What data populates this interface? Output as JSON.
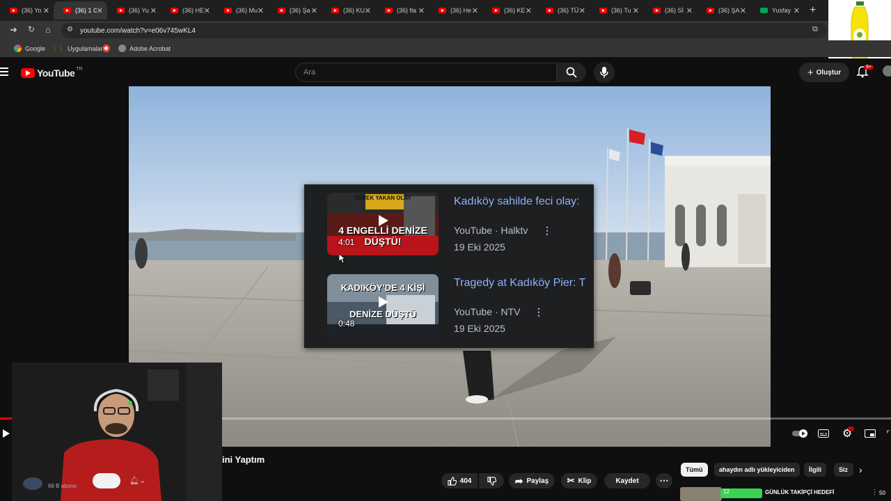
{
  "browser": {
    "tabs": [
      {
        "label": "(36) Yo",
        "active": false
      },
      {
        "label": "(36) 1 G",
        "active": true
      },
      {
        "label": "(36) Yu",
        "active": false
      },
      {
        "label": "(36) HE",
        "active": false
      },
      {
        "label": "(36) Mu",
        "active": false
      },
      {
        "label": "(36) Şa",
        "active": false
      },
      {
        "label": "(36) KU",
        "active": false
      },
      {
        "label": "(36) fla",
        "active": false
      },
      {
        "label": "(36) He",
        "active": false
      },
      {
        "label": "(36) KE",
        "active": false
      },
      {
        "label": "(36) TÜ",
        "active": false
      },
      {
        "label": "(36) Tu",
        "active": false
      },
      {
        "label": "(36) Sİ",
        "active": false
      },
      {
        "label": "(36) ŞA",
        "active": false
      },
      {
        "label": "Yusfay",
        "active": false
      }
    ],
    "url": "youtube.com/watch?v=e06v745wKL4",
    "bookmarks": [
      "Google",
      "Uygulamalar",
      "Adobe Acrobat"
    ]
  },
  "youtube": {
    "logo_text": "YouTube",
    "region": "TR",
    "search_placeholder": "Ara",
    "create_label": "Oluştur",
    "notification_count": "9+"
  },
  "popup": {
    "cards": [
      {
        "title": "Kadıköy sahilde feci olay: ",
        "source": "YouTube · Halktv",
        "date": "19 Eki 2025",
        "duration": "4:01",
        "thumb_text_top": "YÜREK YAKAN OLAY",
        "thumb_text_bottom": "4 ENGELLİ DENİZE DÜŞTÜ!"
      },
      {
        "title": "Tragedy at Kadıköy Pier: T",
        "source": "YouTube · NTV",
        "date": "19 Eki 2025",
        "duration": "0:48",
        "thumb_text_top": "KADIKÖY'DE 4 KİŞİ",
        "thumb_text_bottom": "DENİZE DÜŞTÜ"
      }
    ]
  },
  "video": {
    "title_visible": "ini Yaptım",
    "subscribers": "66 B abone",
    "like_count": "404",
    "share_label": "Paylaş",
    "clip_label": "Klip",
    "save_label": "Kaydet"
  },
  "chips": [
    "Tümü",
    "ahaydın adlı yükleyiciden",
    "İlgili",
    "Siz"
  ],
  "related_overlay": {
    "text": "GÜNLÜK TAKİPÇİ HEDEFİ",
    "count_left": "12",
    "count_right": "50"
  },
  "colors": {
    "youtube_red": "#ff0000",
    "link_blue": "#8ab4f8",
    "background": "#0f0f0f"
  }
}
